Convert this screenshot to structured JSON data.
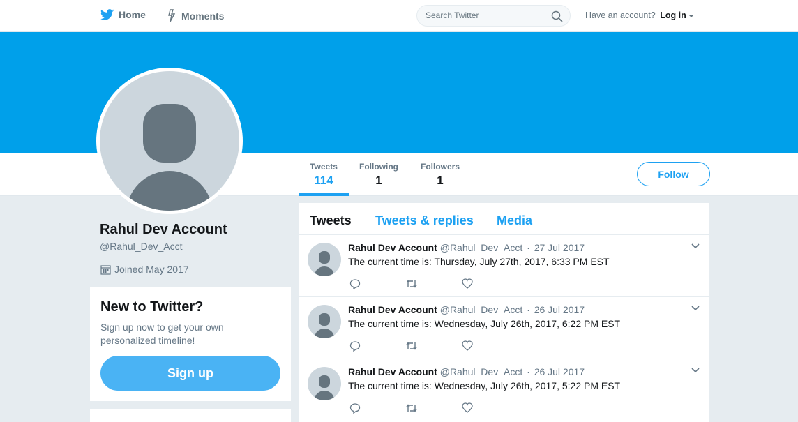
{
  "nav": {
    "home": "Home",
    "moments": "Moments",
    "search_placeholder": "Search Twitter",
    "have_account": "Have an account?",
    "login": "Log in"
  },
  "profile": {
    "name": "Rahul Dev Account",
    "handle": "@Rahul_Dev_Acct",
    "joined": "Joined May 2017"
  },
  "stats": [
    {
      "label": "Tweets",
      "value": "114"
    },
    {
      "label": "Following",
      "value": "1"
    },
    {
      "label": "Followers",
      "value": "1"
    }
  ],
  "follow_label": "Follow",
  "signup": {
    "title": "New to Twitter?",
    "text": "Sign up now to get your own personalized timeline!",
    "button": "Sign up"
  },
  "timeline": {
    "tabs": [
      "Tweets",
      "Tweets & replies",
      "Media"
    ],
    "tweets": [
      {
        "author": "Rahul Dev Account",
        "handle": "@Rahul_Dev_Acct",
        "date": "27 Jul 2017",
        "text": "The current time is: Thursday, July 27th, 2017, 6:33 PM EST"
      },
      {
        "author": "Rahul Dev Account",
        "handle": "@Rahul_Dev_Acct",
        "date": "26 Jul 2017",
        "text": "The current time is: Wednesday, July 26th, 2017, 6:22 PM EST"
      },
      {
        "author": "Rahul Dev Account",
        "handle": "@Rahul_Dev_Acct",
        "date": "26 Jul 2017",
        "text": "The current time is: Wednesday, July 26th, 2017, 5:22 PM EST"
      }
    ]
  },
  "colors": {
    "accent": "#1da1f2",
    "banner": "#00a0ea",
    "muted": "#657786"
  },
  "icons": [
    "twitter-bird-icon",
    "moments-bolt-icon",
    "search-icon",
    "calendar-icon",
    "reply-icon",
    "retweet-icon",
    "like-heart-icon",
    "chevron-down-icon",
    "default-avatar-icon"
  ]
}
